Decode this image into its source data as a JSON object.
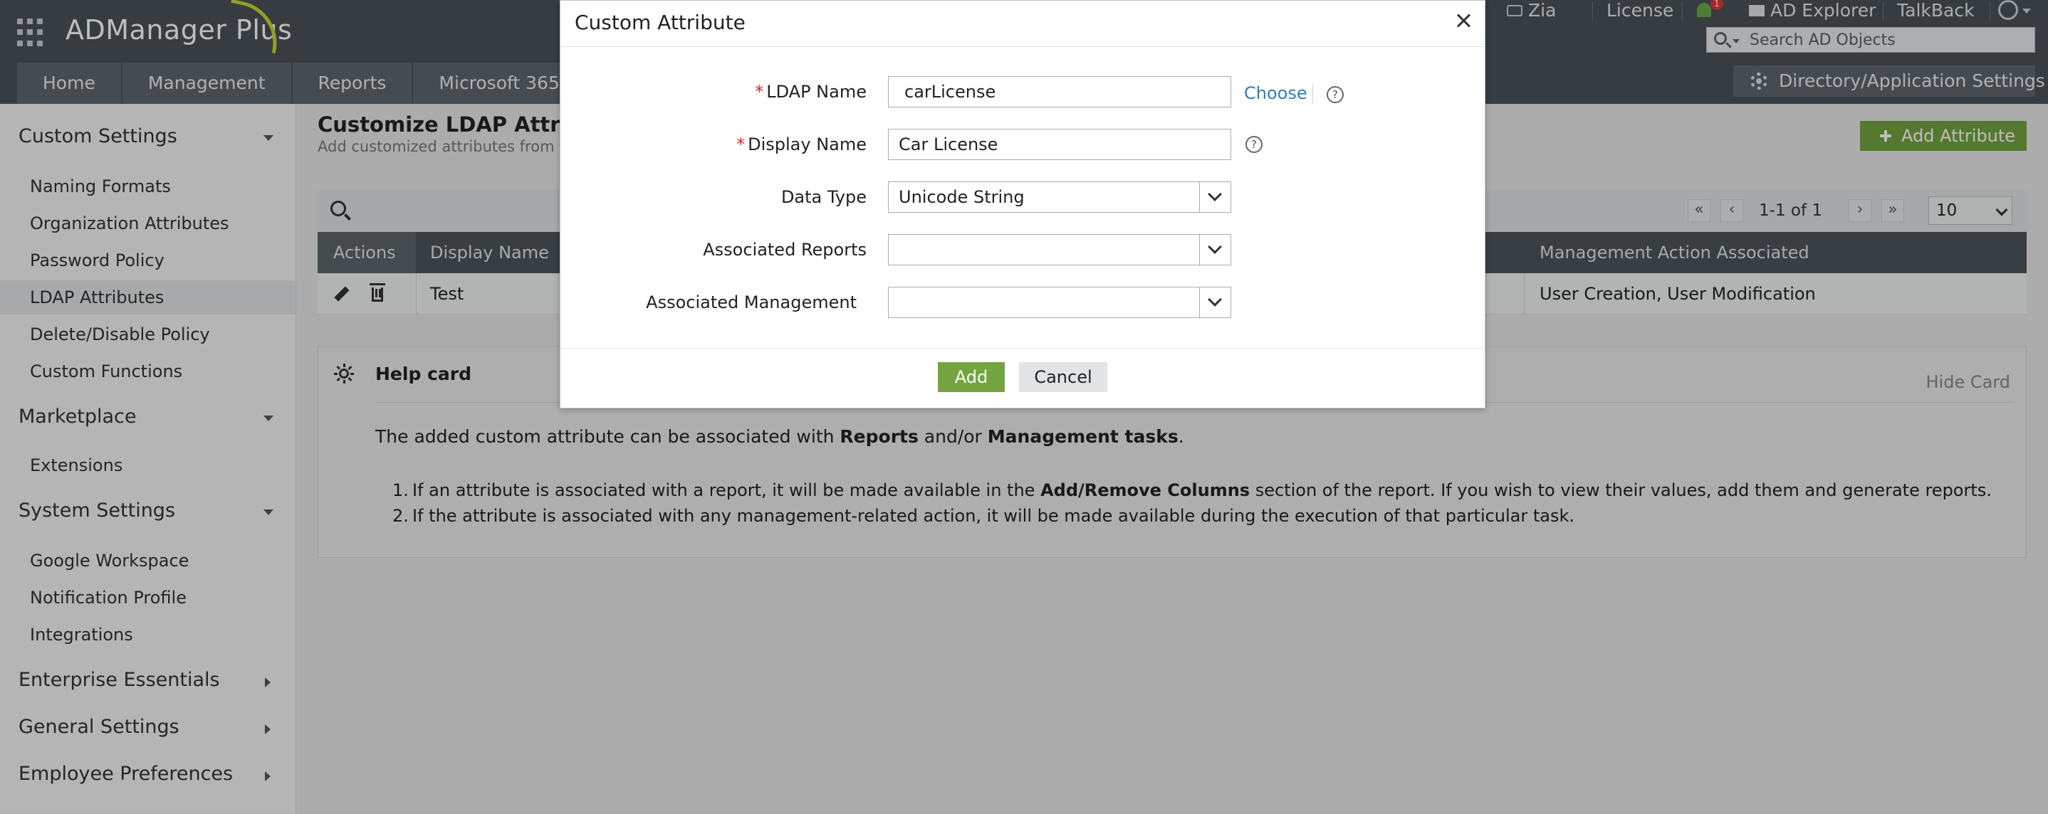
{
  "header": {
    "brand": "ADManager Plus",
    "zia": "Zia",
    "license": "License",
    "notif_count": "1",
    "ad_explorer": "AD Explorer",
    "talkback": "TalkBack",
    "search_placeholder": "Search AD Objects"
  },
  "nav": {
    "tabs": [
      "Home",
      "Management",
      "Reports",
      "Microsoft 365"
    ],
    "dir_settings": "Directory/Application Settings"
  },
  "sidebar": {
    "custom_settings": "Custom Settings",
    "custom_items": [
      "Naming Formats",
      "Organization Attributes",
      "Password Policy",
      "LDAP Attributes",
      "Delete/Disable Policy",
      "Custom Functions"
    ],
    "marketplace": "Marketplace",
    "marketplace_items": [
      "Extensions"
    ],
    "system_settings": "System Settings",
    "system_items": [
      "Google Workspace",
      "Notification Profile",
      "Integrations"
    ],
    "enterprise": "Enterprise Essentials",
    "general": "General Settings",
    "employee": "Employee Preferences"
  },
  "page": {
    "title": "Customize LDAP Attributes",
    "subtitle": "Add customized attributes from ex",
    "add_attribute": "Add Attribute"
  },
  "pagination": {
    "range": "1-1 of 1",
    "page_size": "10"
  },
  "table": {
    "headers": {
      "actions": "Actions",
      "display_name": "Display Name",
      "management": "Management Action Associated"
    },
    "rows": [
      {
        "display_name": "Test",
        "management": "User Creation, User Modification"
      }
    ]
  },
  "helpcard": {
    "title": "Help card",
    "hide": "Hide Card",
    "p_pre": "The added custom attribute can be associated with ",
    "p_b1": "Reports",
    "p_mid": " and/or ",
    "p_b2": "Management tasks",
    "p_end": ".",
    "li1_num": "1.",
    "li1_pre": "If an attribute is associated with a report, it will be made available in the ",
    "li1_bold": "Add/Remove Columns",
    "li1_post": " section of the report. If you wish to view their values, add them and generate reports.",
    "li2_num": "2.",
    "li2": "If the attribute is associated with any management-related action, it will be made available during the execution of that particular task."
  },
  "modal": {
    "title": "Custom Attribute",
    "ldap_label": "LDAP Name",
    "ldap_value": "carLicense",
    "choose": "Choose",
    "display_label": "Display Name",
    "display_value": "Car License",
    "datatype_label": "Data Type",
    "datatype_value": "Unicode String",
    "reports_label": "Associated Reports",
    "reports_value": "",
    "management_label": "Associated Management",
    "management_value": "",
    "add": "Add",
    "cancel": "Cancel",
    "required_mark": "*",
    "help_mark": "?"
  }
}
